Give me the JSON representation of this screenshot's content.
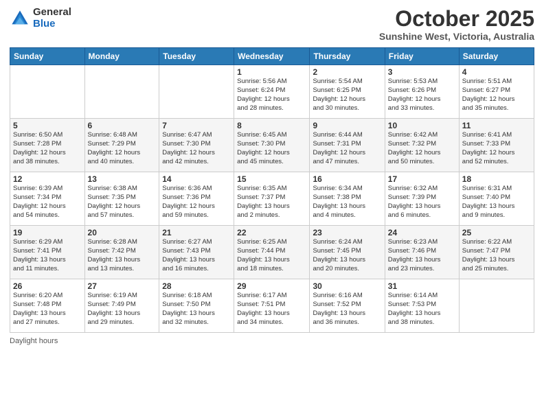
{
  "header": {
    "logo_general": "General",
    "logo_blue": "Blue",
    "month_title": "October 2025",
    "subtitle": "Sunshine West, Victoria, Australia"
  },
  "weekdays": [
    "Sunday",
    "Monday",
    "Tuesday",
    "Wednesday",
    "Thursday",
    "Friday",
    "Saturday"
  ],
  "weeks": [
    [
      {
        "day": "",
        "info": ""
      },
      {
        "day": "",
        "info": ""
      },
      {
        "day": "",
        "info": ""
      },
      {
        "day": "1",
        "info": "Sunrise: 5:56 AM\nSunset: 6:24 PM\nDaylight: 12 hours\nand 28 minutes."
      },
      {
        "day": "2",
        "info": "Sunrise: 5:54 AM\nSunset: 6:25 PM\nDaylight: 12 hours\nand 30 minutes."
      },
      {
        "day": "3",
        "info": "Sunrise: 5:53 AM\nSunset: 6:26 PM\nDaylight: 12 hours\nand 33 minutes."
      },
      {
        "day": "4",
        "info": "Sunrise: 5:51 AM\nSunset: 6:27 PM\nDaylight: 12 hours\nand 35 minutes."
      }
    ],
    [
      {
        "day": "5",
        "info": "Sunrise: 6:50 AM\nSunset: 7:28 PM\nDaylight: 12 hours\nand 38 minutes."
      },
      {
        "day": "6",
        "info": "Sunrise: 6:48 AM\nSunset: 7:29 PM\nDaylight: 12 hours\nand 40 minutes."
      },
      {
        "day": "7",
        "info": "Sunrise: 6:47 AM\nSunset: 7:30 PM\nDaylight: 12 hours\nand 42 minutes."
      },
      {
        "day": "8",
        "info": "Sunrise: 6:45 AM\nSunset: 7:30 PM\nDaylight: 12 hours\nand 45 minutes."
      },
      {
        "day": "9",
        "info": "Sunrise: 6:44 AM\nSunset: 7:31 PM\nDaylight: 12 hours\nand 47 minutes."
      },
      {
        "day": "10",
        "info": "Sunrise: 6:42 AM\nSunset: 7:32 PM\nDaylight: 12 hours\nand 50 minutes."
      },
      {
        "day": "11",
        "info": "Sunrise: 6:41 AM\nSunset: 7:33 PM\nDaylight: 12 hours\nand 52 minutes."
      }
    ],
    [
      {
        "day": "12",
        "info": "Sunrise: 6:39 AM\nSunset: 7:34 PM\nDaylight: 12 hours\nand 54 minutes."
      },
      {
        "day": "13",
        "info": "Sunrise: 6:38 AM\nSunset: 7:35 PM\nDaylight: 12 hours\nand 57 minutes."
      },
      {
        "day": "14",
        "info": "Sunrise: 6:36 AM\nSunset: 7:36 PM\nDaylight: 12 hours\nand 59 minutes."
      },
      {
        "day": "15",
        "info": "Sunrise: 6:35 AM\nSunset: 7:37 PM\nDaylight: 13 hours\nand 2 minutes."
      },
      {
        "day": "16",
        "info": "Sunrise: 6:34 AM\nSunset: 7:38 PM\nDaylight: 13 hours\nand 4 minutes."
      },
      {
        "day": "17",
        "info": "Sunrise: 6:32 AM\nSunset: 7:39 PM\nDaylight: 13 hours\nand 6 minutes."
      },
      {
        "day": "18",
        "info": "Sunrise: 6:31 AM\nSunset: 7:40 PM\nDaylight: 13 hours\nand 9 minutes."
      }
    ],
    [
      {
        "day": "19",
        "info": "Sunrise: 6:29 AM\nSunset: 7:41 PM\nDaylight: 13 hours\nand 11 minutes."
      },
      {
        "day": "20",
        "info": "Sunrise: 6:28 AM\nSunset: 7:42 PM\nDaylight: 13 hours\nand 13 minutes."
      },
      {
        "day": "21",
        "info": "Sunrise: 6:27 AM\nSunset: 7:43 PM\nDaylight: 13 hours\nand 16 minutes."
      },
      {
        "day": "22",
        "info": "Sunrise: 6:25 AM\nSunset: 7:44 PM\nDaylight: 13 hours\nand 18 minutes."
      },
      {
        "day": "23",
        "info": "Sunrise: 6:24 AM\nSunset: 7:45 PM\nDaylight: 13 hours\nand 20 minutes."
      },
      {
        "day": "24",
        "info": "Sunrise: 6:23 AM\nSunset: 7:46 PM\nDaylight: 13 hours\nand 23 minutes."
      },
      {
        "day": "25",
        "info": "Sunrise: 6:22 AM\nSunset: 7:47 PM\nDaylight: 13 hours\nand 25 minutes."
      }
    ],
    [
      {
        "day": "26",
        "info": "Sunrise: 6:20 AM\nSunset: 7:48 PM\nDaylight: 13 hours\nand 27 minutes."
      },
      {
        "day": "27",
        "info": "Sunrise: 6:19 AM\nSunset: 7:49 PM\nDaylight: 13 hours\nand 29 minutes."
      },
      {
        "day": "28",
        "info": "Sunrise: 6:18 AM\nSunset: 7:50 PM\nDaylight: 13 hours\nand 32 minutes."
      },
      {
        "day": "29",
        "info": "Sunrise: 6:17 AM\nSunset: 7:51 PM\nDaylight: 13 hours\nand 34 minutes."
      },
      {
        "day": "30",
        "info": "Sunrise: 6:16 AM\nSunset: 7:52 PM\nDaylight: 13 hours\nand 36 minutes."
      },
      {
        "day": "31",
        "info": "Sunrise: 6:14 AM\nSunset: 7:53 PM\nDaylight: 13 hours\nand 38 minutes."
      },
      {
        "day": "",
        "info": ""
      }
    ]
  ],
  "footer": {
    "daylight_label": "Daylight hours"
  }
}
